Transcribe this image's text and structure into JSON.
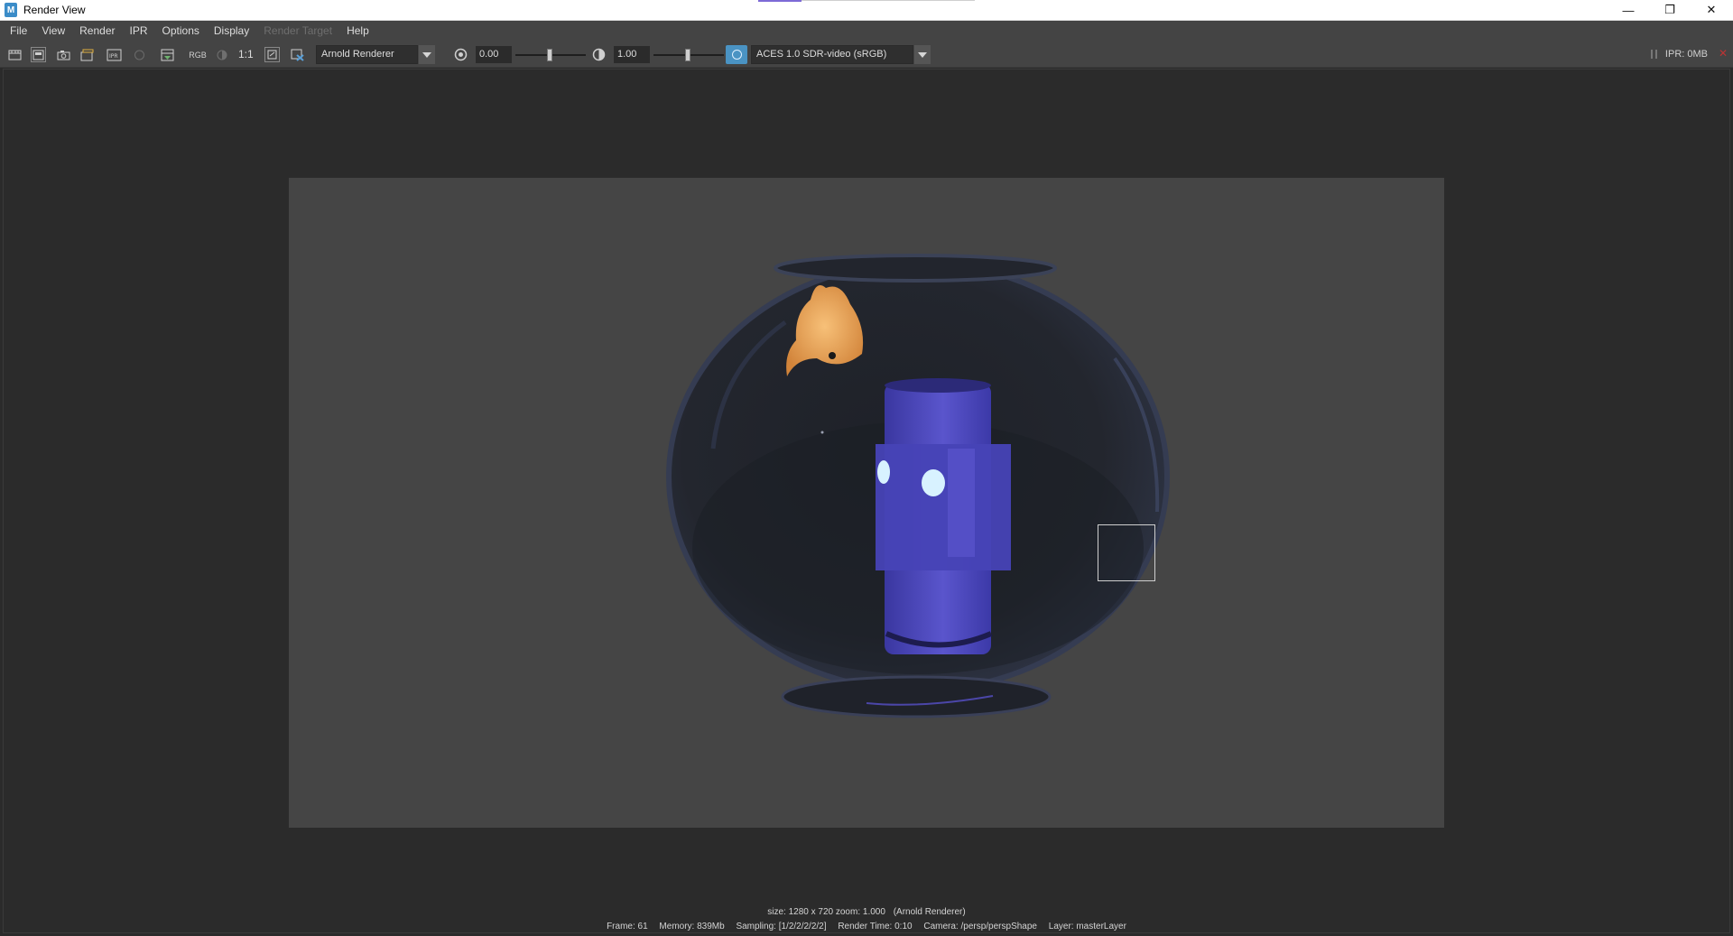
{
  "window": {
    "title": "Render View",
    "app_icon_letter": "M",
    "controls": {
      "minimize": "—",
      "restore": "❐",
      "close": "✕"
    }
  },
  "menu": {
    "items": [
      "File",
      "View",
      "Render",
      "IPR",
      "Options",
      "Display",
      "Render Target",
      "Help"
    ],
    "disabled": [
      "Render Target"
    ]
  },
  "toolbar": {
    "rgb_label": "RGB",
    "one_to_one_label": "1:1",
    "renderer": "Arnold Renderer",
    "exposure": "0.00",
    "gamma": "1.00",
    "view_transform": "ACES 1.0 SDR-video (sRGB)",
    "ipr_memory": "IPR: 0MB",
    "icons": [
      "render-frame-icon",
      "render-region-icon",
      "snapshot-icon",
      "render-sequence-icon",
      "ipr-render-icon",
      "refresh-ipr-icon",
      "keep-image-icon",
      "rgb-channels-icon",
      "display-alpha-icon",
      "one-to-one-icon",
      "frame-image-icon",
      "remove-image-icon",
      "exposure-icon",
      "gamma-icon",
      "color-management-icon"
    ]
  },
  "viewport": {
    "size_line": {
      "size": "size: 1280 x 720 zoom: 1.000",
      "renderer": "(Arnold Renderer)"
    },
    "info_line": {
      "frame": "Frame: 61",
      "memory": "Memory: 839Mb",
      "sampling": "Sampling: [1/2/2/2/2/2]",
      "render_time": "Render Time: 0:10",
      "camera": "Camera: /persp/perspShape",
      "layer": "Layer: masterLayer"
    }
  },
  "colors": {
    "background": "#2b2b2b",
    "panel": "#444444",
    "render_bg": "#454545",
    "bowl": "#1e2128",
    "tiki": "#4a46b8",
    "fish": "#e39a4f",
    "eyes": "#d8f2ff",
    "ocio_accent": "#4a93c3"
  }
}
